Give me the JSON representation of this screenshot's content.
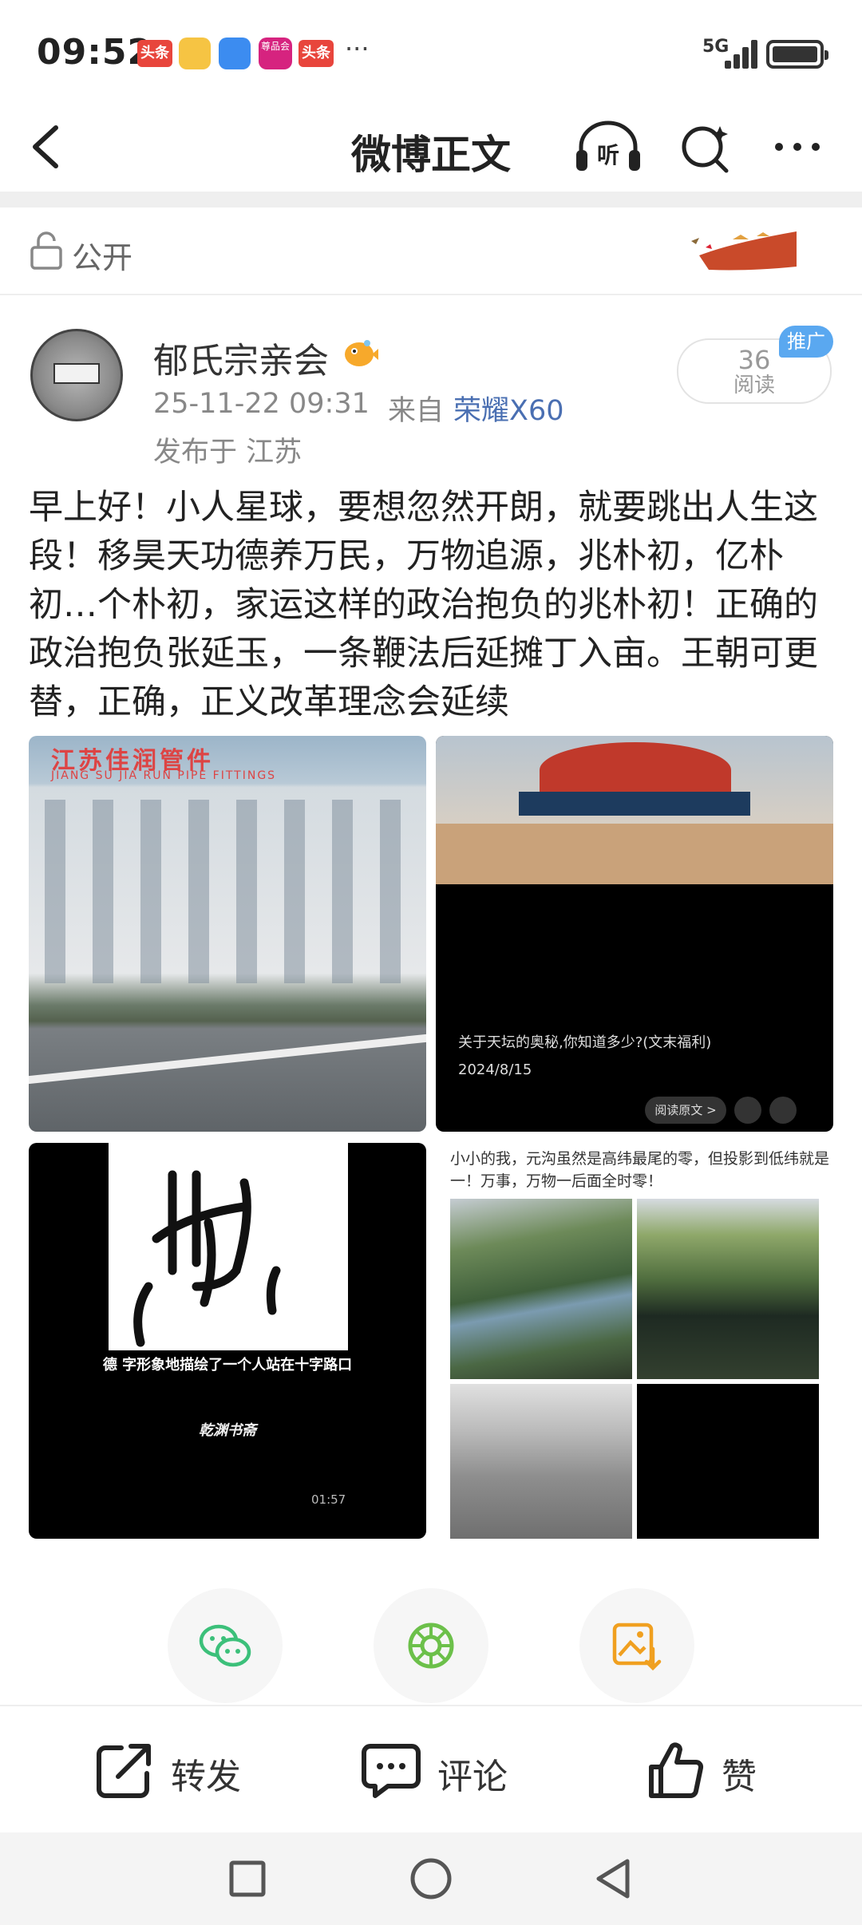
{
  "status_bar": {
    "time": "09:52",
    "notifications": [
      {
        "name": "toutiao",
        "label": "头条"
      },
      {
        "name": "weibo",
        "label": ""
      },
      {
        "name": "messages",
        "label": ""
      },
      {
        "name": "pinpin",
        "label": "尊品会"
      },
      {
        "name": "toutiao",
        "label": "头条"
      }
    ],
    "more": "···",
    "network": "5G"
  },
  "header": {
    "title": "微博正文",
    "listen_label": "听"
  },
  "visibility": {
    "label": "公开"
  },
  "author": {
    "name": "郁氏宗亲会",
    "timestamp": "25-11-22 09:31",
    "from_label": "来自",
    "device": "荣耀X60",
    "location": "发布于 江苏"
  },
  "reads": {
    "count": "36",
    "label": "阅读",
    "ad_tag": "推广"
  },
  "post": {
    "text": "早上好！小人星球，要想忽然开朗，就要跳出人生这段！移昊天功德养万民，万物追源，兆朴初，亿朴初…个朴初，家运这样的政治抱负的兆朴初！正确的政治抱负张延玉，一条鞭法后延摊丁入亩。王朝可更替，正确，正义改革理念会延续"
  },
  "images": [
    {
      "sign_cn": "江苏佳润管件",
      "sign_en": "JIANG SU JIA RUN PIPE FITTINGS"
    },
    {
      "caption": "关于天坛的奥秘,你知道多少?(文末福利)",
      "date": "2024/8/15",
      "read_original": "阅读原文 >"
    },
    {
      "subtitle": "德 字形象地描绘了一个人站在十字路口",
      "brand": "乾渊书斋",
      "duration": "01:57"
    },
    {
      "caption": "小小的我，元沟虽然是高纬最尾的零，但投影到低纬就是一！万事，万物一后面全时零！"
    }
  ],
  "share": {
    "wechat": "wechat-icon",
    "moments": "moments-icon",
    "save": "save-image-icon"
  },
  "actions": {
    "repost": "转发",
    "comment": "评论",
    "like": "赞"
  },
  "colors": {
    "link_blue": "#4a6fb2",
    "ad_blue": "#5aa8f0",
    "wechat_green": "#3cc07a",
    "save_orange": "#f0a020"
  }
}
